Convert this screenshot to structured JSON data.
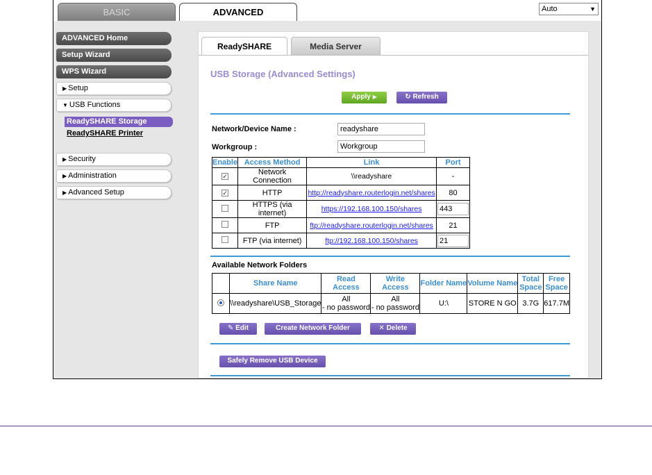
{
  "topbar": {
    "tab_basic": "BASIC",
    "tab_advanced": "ADVANCED",
    "language": "Auto"
  },
  "sidebar": {
    "advanced_home": "ADVANCED Home",
    "setup_wizard": "Setup Wizard",
    "wps_wizard": "WPS Wizard",
    "setup": "Setup",
    "usb_functions": "USB Functions",
    "readyshare_storage": "ReadySHARE Storage",
    "readyshare_printer": "ReadySHARE Printer",
    "security": "Security",
    "administration": "Administration",
    "advanced_setup": "Advanced Setup"
  },
  "tabs": {
    "readyshare": "ReadySHARE",
    "media_server": "Media Server"
  },
  "page_title": "USB Storage (Advanced Settings)",
  "buttons": {
    "apply": "Apply",
    "refresh": "Refresh",
    "edit": "Edit",
    "create_folder": "Create Network Folder",
    "delete": "Delete",
    "safely_remove": "Safely Remove USB Device"
  },
  "device": {
    "name_label": "Network/Device Name :",
    "name_value": "readyshare",
    "workgroup_label": "Workgroup :",
    "workgroup_value": "Workgroup"
  },
  "access": {
    "headers": [
      "Enable",
      "Access Method",
      "Link",
      "Port"
    ],
    "rows": [
      {
        "enabled": true,
        "method": "Network Connection",
        "link": "\\\\readyshare",
        "port": "-",
        "port_editable": false,
        "is_link": false
      },
      {
        "enabled": true,
        "method": "HTTP",
        "link": "http://readyshare.routerlogin.net/shares",
        "port": "80",
        "port_editable": false,
        "is_link": true
      },
      {
        "enabled": false,
        "method": "HTTPS (via internet)",
        "link": "https://192.168.100.150/shares",
        "port": "443",
        "port_editable": true,
        "is_link": true
      },
      {
        "enabled": false,
        "method": "FTP",
        "link": "ftp://readyshare.routerlogin.net/shares",
        "port": "21",
        "port_editable": false,
        "is_link": true
      },
      {
        "enabled": false,
        "method": "FTP (via internet)",
        "link": "ftp://192.168.100.150/shares",
        "port": "21",
        "port_editable": true,
        "is_link": true
      }
    ]
  },
  "folders": {
    "title": "Available Network Folders",
    "headers": {
      "share_name": "Share Name",
      "read_1": "Read",
      "read_2": "Access",
      "write_1": "Write",
      "write_2": "Access",
      "folder_name": "Folder Name",
      "volume_name": "Volume Name",
      "total_1": "Total",
      "total_2": "Space",
      "free_1": "Free",
      "free_2": "Space"
    },
    "row": {
      "share_name": "\\\\readyshare\\USB_Storage",
      "read_1": "All",
      "read_2": "- no password",
      "write_1": "All",
      "write_2": "- no password",
      "folder_name": "U:\\",
      "volume_name": "STORE N GO",
      "total": "3.7G",
      "free": "617.7M"
    }
  },
  "colors": {
    "accent_purple": "#7b5ec2",
    "accent_blue": "#3f9ad8",
    "apply_green": "#6db52c"
  }
}
